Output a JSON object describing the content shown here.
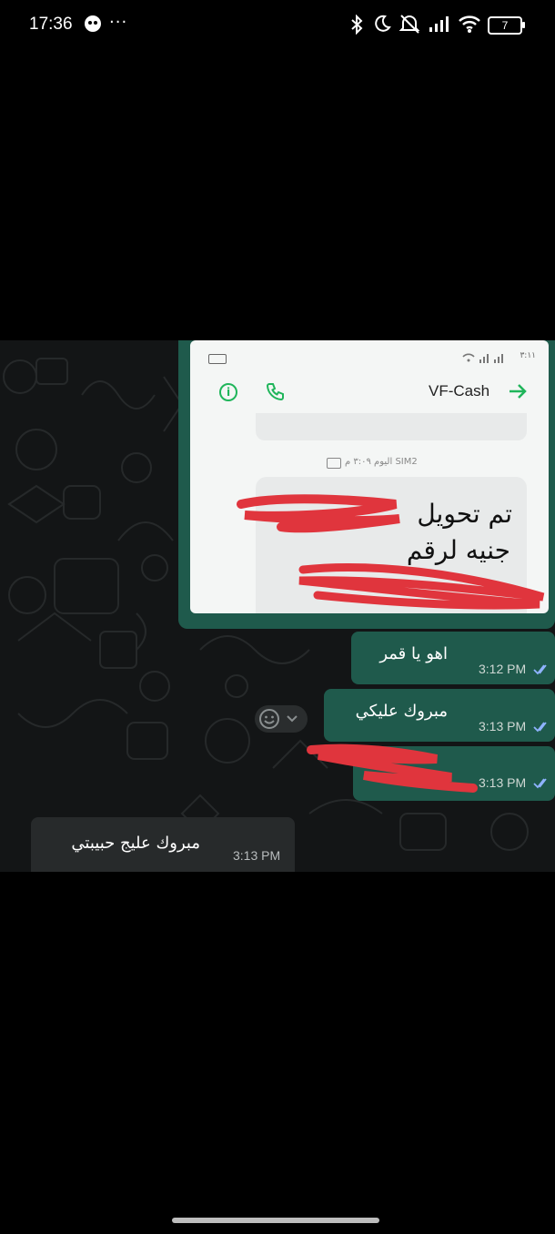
{
  "status_bar": {
    "time": "17:36",
    "more": "···",
    "battery": "7",
    "icons": [
      "face-icon",
      "bluetooth-icon",
      "moon-icon",
      "mute-icon",
      "signal-icon",
      "wifi-icon",
      "battery-icon"
    ]
  },
  "attachment": {
    "sms_app_title": "VF-Cash",
    "date_label": "اليوم ٣:٠٩ م",
    "sim_label": "SIM2",
    "time_label": "٣:١١",
    "message_line1": "تم تحويل",
    "message_line2": "جنيه لرقم",
    "redacted": true
  },
  "messages": [
    {
      "direction": "out",
      "text": "اهو يا قمر",
      "time": "3:12 PM",
      "status": "read"
    },
    {
      "direction": "out",
      "text": "مبروك عليكي",
      "time": "3:13 PM",
      "status": "read"
    },
    {
      "direction": "out",
      "text": "",
      "time": "3:13 PM",
      "status": "read",
      "redacted": true
    },
    {
      "direction": "in",
      "text": "مبروك عليج حبيبتي",
      "time": "3:13 PM"
    }
  ],
  "colors": {
    "outgoing_bubble": "#1f5a4c",
    "incoming_bubble": "#272a2b",
    "chat_background": "#131516",
    "tick_color": "#8fb3ff",
    "scribble": "#e0353d"
  }
}
